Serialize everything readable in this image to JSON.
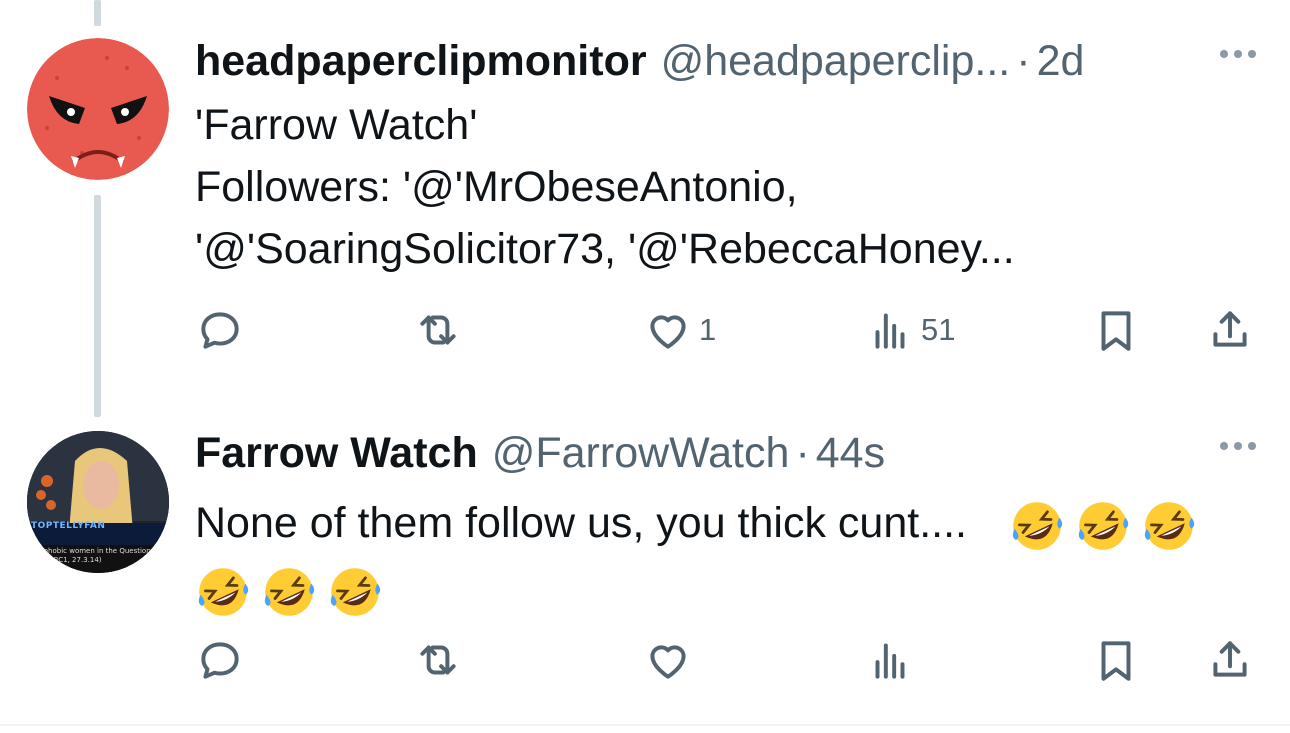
{
  "colors": {
    "text": "#0f1419",
    "muted": "#536471",
    "thread_line": "#cfd9de",
    "avatar1": "#e85a4f"
  },
  "tweets": [
    {
      "display_name": "headpaperclipmonitor",
      "handle": "@headpaperclip...",
      "separator": "·",
      "time": "2d",
      "lines": [
        "'Farrow Watch'",
        "Followers: '@'MrObeseAntonio,",
        "'@'SoaringSolicitor73, '@'RebeccaHoney..."
      ],
      "likes": "1",
      "views": "51",
      "avatar_icon": "angry-red-face-avatar"
    },
    {
      "display_name": "Farrow Watch",
      "handle": "@FarrowWatch",
      "separator": "·",
      "time": "44s",
      "text": "None of them follow us, you thick cunt....",
      "emoji_count": 6,
      "emoji_icon": "rolling-on-floor-laughing-emoji",
      "avatar_icon": "video-still-avatar",
      "avatar_badge": "TOPTELLYFAN",
      "avatar_caption_1": "...sophobic women in the Question T...",
      "avatar_caption_2": "...ce (BBC1, 27.3.14)"
    }
  ]
}
